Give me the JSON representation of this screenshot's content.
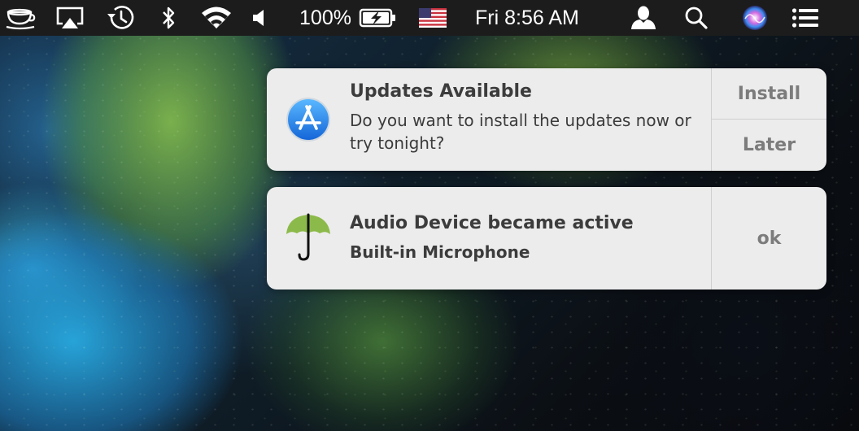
{
  "menubar": {
    "icons": [
      "caffeine-cup-icon",
      "airplay-icon",
      "time-machine-icon",
      "bluetooth-icon",
      "wifi-icon",
      "volume-icon",
      "battery-charging-icon",
      "flag-us-icon",
      "user-icon",
      "spotlight-search-icon",
      "siri-icon",
      "notification-center-icon"
    ],
    "battery_percent": "100%",
    "clock": "Fri 8:56 AM"
  },
  "notifications": [
    {
      "app_icon": "app-store-icon",
      "title": "Updates Available",
      "message": "Do you want to install the updates now or try tonight?",
      "actions": [
        "Install",
        "Later"
      ]
    },
    {
      "app_icon": "umbrella-icon",
      "title": "Audio Device became active",
      "message": "Built-in Microphone",
      "actions": [
        "ok"
      ]
    }
  ],
  "colors": {
    "menubar_bg": "#1c1c1c",
    "notification_bg": "#ececec",
    "app_store_blue": "#2a8ef0",
    "umbrella_green": "#8cba4a"
  }
}
